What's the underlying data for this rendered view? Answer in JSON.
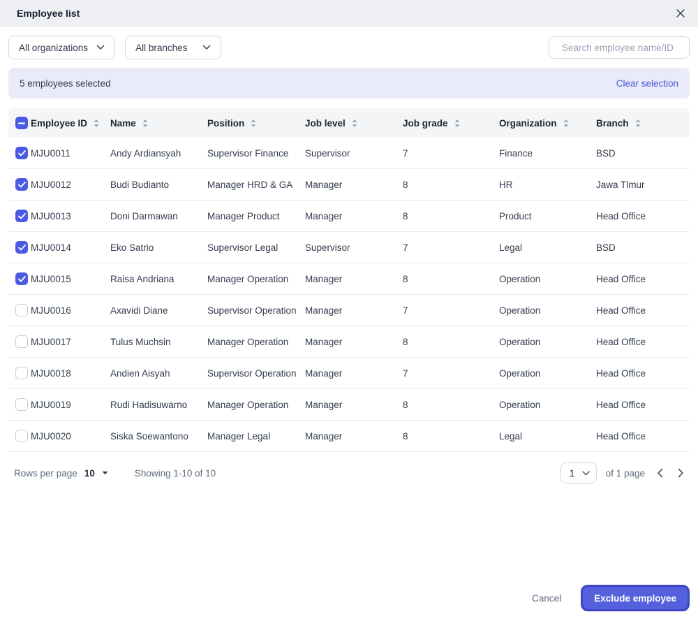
{
  "modal": {
    "title": "Employee list"
  },
  "filters": {
    "organizations_label": "All organizations",
    "branches_label": "All branches"
  },
  "search": {
    "placeholder": "Search employee name/ID"
  },
  "selection": {
    "count_text": "5 employees selected",
    "clear_label": "Clear selection"
  },
  "table": {
    "columns": [
      "Employee ID",
      "Name",
      "Position",
      "Job level",
      "Job grade",
      "Organization",
      "Branch"
    ],
    "header_checkbox_state": "indeterminate",
    "rows": [
      {
        "checked": true,
        "id": "MJU0011",
        "name": "Andy Ardiansyah",
        "position": "Supervisor Finance",
        "job_level": "Supervisor",
        "job_grade": "7",
        "organization": "Finance",
        "branch": "BSD"
      },
      {
        "checked": true,
        "id": "MJU0012",
        "name": "Budi Budianto",
        "position": "Manager HRD & GA",
        "job_level": "Manager",
        "job_grade": "8",
        "organization": "HR",
        "branch": "Jawa Tlmur"
      },
      {
        "checked": true,
        "id": "MJU0013",
        "name": "Doni Darmawan",
        "position": "Manager Product",
        "job_level": "Manager",
        "job_grade": "8",
        "organization": "Product",
        "branch": "Head Office"
      },
      {
        "checked": true,
        "id": "MJU0014",
        "name": "Eko Satrio",
        "position": "Supervisor Legal",
        "job_level": "Supervisor",
        "job_grade": "7",
        "organization": "Legal",
        "branch": "BSD"
      },
      {
        "checked": true,
        "id": "MJU0015",
        "name": "Raisa Andriana",
        "position": "Manager Operation",
        "job_level": "Manager",
        "job_grade": "8",
        "organization": "Operation",
        "branch": "Head Office"
      },
      {
        "checked": false,
        "id": "MJU0016",
        "name": "Axavidi Diane",
        "position": "Supervisor Operation",
        "job_level": "Manager",
        "job_grade": "7",
        "organization": "Operation",
        "branch": "Head Office"
      },
      {
        "checked": false,
        "id": "MJU0017",
        "name": "Tulus Muchsin",
        "position": "Manager Operation",
        "job_level": "Manager",
        "job_grade": "8",
        "organization": "Operation",
        "branch": "Head Office"
      },
      {
        "checked": false,
        "id": "MJU0018",
        "name": "Andien Aisyah",
        "position": "Supervisor Operation",
        "job_level": "Manager",
        "job_grade": "7",
        "organization": "Operation",
        "branch": "Head Office"
      },
      {
        "checked": false,
        "id": "MJU0019",
        "name": "Rudi Hadisuwarno",
        "position": "Manager Operation",
        "job_level": "Manager",
        "job_grade": "8",
        "organization": "Operation",
        "branch": "Head Office"
      },
      {
        "checked": false,
        "id": "MJU0020",
        "name": "Siska Soewantono",
        "position": "Manager Legal",
        "job_level": "Manager",
        "job_grade": "8",
        "organization": "Legal",
        "branch": "Head Office"
      }
    ]
  },
  "pagination": {
    "rows_per_page_label": "Rows per page",
    "rows_per_page_value": "10",
    "showing_text": "Showing 1-10 of 10",
    "page_value": "1",
    "of_pages_label": "of 1 page"
  },
  "actions": {
    "cancel_label": "Cancel",
    "exclude_label": "Exclude employee"
  },
  "colors": {
    "accent": "#4c59e3",
    "banner_bg": "#e9ebf9",
    "link": "#4757d8",
    "button_fill": "#5560dd",
    "button_ring": "#3b47c6"
  }
}
